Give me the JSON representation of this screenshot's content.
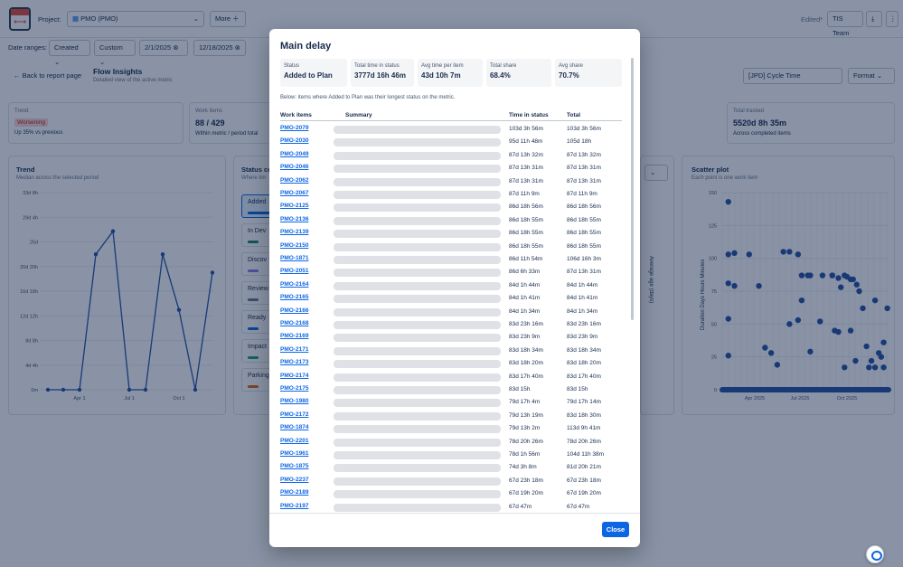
{
  "header": {
    "project_label": "Project:",
    "project_value": "PMO (PMO)",
    "more_label": "More",
    "edited_label": "Edited*",
    "team_label": "TIS Team"
  },
  "filters": {
    "date_ranges_label": "Date ranges:",
    "created": "Created",
    "custom": "Custom",
    "from": "2/1/2025",
    "to": "12/18/2025"
  },
  "nav": {
    "back": "Back to report page",
    "title": "Flow Insights",
    "subtitle": "Detailed view of the active metric",
    "metric_select": "[JPD] Cycle Time",
    "format_label": "Format"
  },
  "cards": {
    "trend": {
      "title": "Trend",
      "badge": "Worsening",
      "sub": "Up 35% vs previous"
    },
    "work": {
      "title": "Work items",
      "value": "88 / 429",
      "sub": "Within metric / period total"
    },
    "tracked": {
      "title": "Total tracked",
      "value": "5520d 8h 35m",
      "sub": "Across completed items"
    }
  },
  "panels": {
    "trend": {
      "title": "Trend",
      "sub": "Median across the selected period"
    },
    "status": {
      "title": "Status co",
      "sub": "Where tim",
      "items": [
        "Added",
        "In Dev",
        "Discov",
        "Review",
        "Ready",
        "Impact",
        "Parking"
      ]
    },
    "avg_label": "Average age (days)",
    "scatter": {
      "title": "Scatter plot",
      "sub": "Each point is one work item",
      "ylabel": "Duration Days Hours Minutes"
    }
  },
  "chart_data": [
    {
      "type": "line",
      "title": "Trend",
      "x_ticks": [
        "Apr 1",
        "Jul 1",
        "Oct 1"
      ],
      "y_ticks": [
        "0m",
        "4d 4h",
        "8d 8h",
        "12d 12h",
        "16d 16h",
        "20d 20h",
        "25d",
        "29d 4h",
        "33d 8h"
      ],
      "values": [
        0,
        0,
        0,
        22.9,
        26.8,
        0,
        0,
        22.9,
        13.5,
        0,
        19.8
      ]
    },
    {
      "type": "scatter",
      "title": "Scatter plot",
      "x_ticks": [
        "Apr 2025",
        "Jul 2025",
        "Oct 2025"
      ],
      "y_ticks": [
        "0",
        "25",
        "50",
        "75",
        "100",
        "125",
        "150"
      ],
      "ylim": [
        0,
        150
      ],
      "points": [
        [
          0.05,
          143
        ],
        [
          0.05,
          103
        ],
        [
          0.05,
          81
        ],
        [
          0.05,
          54
        ],
        [
          0.05,
          26
        ],
        [
          0.1,
          104
        ],
        [
          0.1,
          79
        ],
        [
          0.22,
          103
        ],
        [
          0.3,
          79
        ],
        [
          0.35,
          32
        ],
        [
          0.4,
          28
        ],
        [
          0.45,
          19
        ],
        [
          0.5,
          105
        ],
        [
          0.55,
          105
        ],
        [
          0.55,
          50
        ],
        [
          0.62,
          103
        ],
        [
          0.62,
          53
        ],
        [
          0.65,
          68
        ],
        [
          0.65,
          87
        ],
        [
          0.7,
          87
        ],
        [
          0.72,
          87
        ],
        [
          0.72,
          29
        ],
        [
          0.8,
          52
        ],
        [
          0.82,
          87
        ],
        [
          0.9,
          87
        ],
        [
          0.9,
          87
        ],
        [
          0.92,
          45
        ],
        [
          0.95,
          85
        ],
        [
          0.97,
          78
        ],
        [
          1,
          87
        ],
        [
          1.02,
          86
        ],
        [
          1.05,
          84
        ],
        [
          1.07,
          84
        ],
        [
          1.09,
          22
        ],
        [
          1.1,
          80
        ],
        [
          1.12,
          75
        ],
        [
          1.15,
          62
        ],
        [
          1.18,
          33
        ],
        [
          1.2,
          17
        ],
        [
          1.22,
          22
        ],
        [
          1.25,
          17
        ],
        [
          1.25,
          68
        ],
        [
          1.28,
          28
        ],
        [
          1.3,
          25
        ],
        [
          1.32,
          36
        ],
        [
          1.32,
          17
        ],
        [
          1.35,
          62
        ],
        [
          1.0,
          17
        ],
        [
          0.95,
          44
        ],
        [
          1.05,
          45
        ]
      ]
    }
  ],
  "modal": {
    "title": "Main delay",
    "stats": [
      {
        "k": "Status",
        "v": "Added to Plan"
      },
      {
        "k": "Total time in status",
        "v": "3777d 16h 46m"
      },
      {
        "k": "Avg time per item",
        "v": "43d 10h 7m"
      },
      {
        "k": "Total share",
        "v": "68.4%"
      },
      {
        "k": "Avg share",
        "v": "70.7%"
      }
    ],
    "note": "Below: items where Added to Plan was their longest status on the metric.",
    "columns": [
      "Work items",
      "Summary",
      "Time in status",
      "Total"
    ],
    "rows": [
      [
        "PMO-2079",
        "103d 3h 56m",
        "103d 3h 56m"
      ],
      [
        "PMO-2030",
        "95d 11h 48m",
        "105d 18h"
      ],
      [
        "PMO-2049",
        "87d 13h 32m",
        "87d 13h 32m"
      ],
      [
        "PMO-2046",
        "87d 13h 31m",
        "87d 13h 31m"
      ],
      [
        "PMO-2062",
        "87d 13h 31m",
        "87d 13h 31m"
      ],
      [
        "PMO-2067",
        "87d 11h 9m",
        "87d 11h 9m"
      ],
      [
        "PMO-2125",
        "86d 18h 56m",
        "86d 18h 56m"
      ],
      [
        "PMO-2136",
        "86d 18h 55m",
        "86d 18h 55m"
      ],
      [
        "PMO-2139",
        "86d 18h 55m",
        "86d 18h 55m"
      ],
      [
        "PMO-2150",
        "86d 18h 55m",
        "86d 18h 55m"
      ],
      [
        "PMO-1871",
        "86d 11h 54m",
        "106d 16h 3m"
      ],
      [
        "PMO-2051",
        "86d 6h 33m",
        "87d 13h 31m"
      ],
      [
        "PMO-2164",
        "84d 1h 44m",
        "84d 1h 44m"
      ],
      [
        "PMO-2165",
        "84d 1h 41m",
        "84d 1h 41m"
      ],
      [
        "PMO-2166",
        "84d 1h 34m",
        "84d 1h 34m"
      ],
      [
        "PMO-2168",
        "83d 23h 16m",
        "83d 23h 16m"
      ],
      [
        "PMO-2169",
        "83d 23h 9m",
        "83d 23h 9m"
      ],
      [
        "PMO-2171",
        "83d 18h 34m",
        "83d 18h 34m"
      ],
      [
        "PMO-2173",
        "83d 18h 20m",
        "83d 18h 20m"
      ],
      [
        "PMO-2174",
        "83d 17h 40m",
        "83d 17h 40m"
      ],
      [
        "PMO-2175",
        "83d 15h",
        "83d 15h"
      ],
      [
        "PMO-1980",
        "79d 17h 4m",
        "79d 17h 14m"
      ],
      [
        "PMO-2172",
        "79d 13h 19m",
        "83d 18h 30m"
      ],
      [
        "PMO-1874",
        "79d 13h 2m",
        "113d 9h 41m"
      ],
      [
        "PMO-2201",
        "78d 20h 26m",
        "78d 20h 26m"
      ],
      [
        "PMO-1961",
        "78d 1h 56m",
        "104d 11h 38m"
      ],
      [
        "PMO-1875",
        "74d 3h 8m",
        "81d 20h 21m"
      ],
      [
        "PMO-2237",
        "67d 23h 18m",
        "67d 23h 18m"
      ],
      [
        "PMO-2189",
        "67d 19h 20m",
        "67d 19h 20m"
      ],
      [
        "PMO-2197",
        "67d 47m",
        "67d 47m"
      ]
    ],
    "close_label": "Close"
  }
}
